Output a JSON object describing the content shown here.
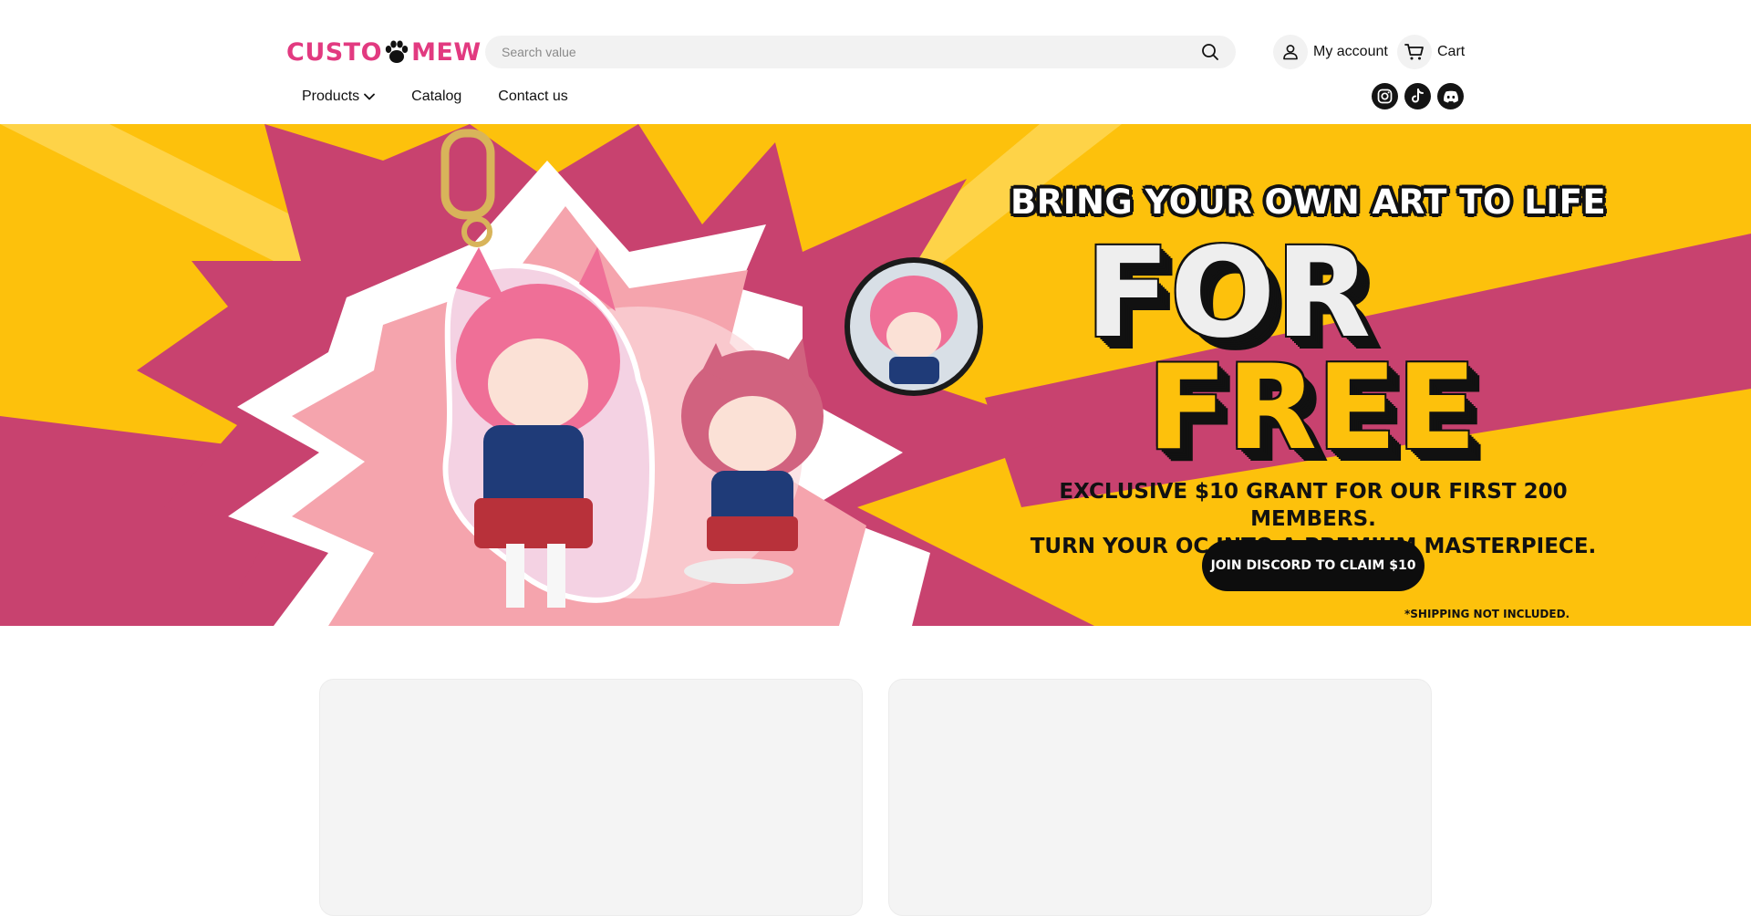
{
  "brand": {
    "logo_left": "CUSTO",
    "logo_right": "MEW",
    "logo_color": "#e23a80"
  },
  "search": {
    "placeholder": "Search value",
    "icon": "search-icon"
  },
  "header": {
    "account_label": "My account",
    "cart_label": "Cart"
  },
  "nav": {
    "items": [
      {
        "label": "Products",
        "has_dropdown": true
      },
      {
        "label": "Catalog",
        "has_dropdown": false
      },
      {
        "label": "Contact us",
        "has_dropdown": false
      }
    ]
  },
  "socials": [
    "instagram-icon",
    "tiktok-icon",
    "discord-icon"
  ],
  "hero": {
    "headline": "BRING YOUR OWN ART TO LIFE",
    "big_1": "FOR",
    "big_2": "FREE",
    "subline_1": "EXCLUSIVE $10 GRANT FOR OUR FIRST 200 MEMBERS.",
    "subline_2": "TURN YOUR OC INTO A PREMIUM MASTERPIECE.",
    "cta_label": "JOIN DISCORD TO CLAIM $10",
    "footnote": "*SHIPPING NOT INCLUDED.",
    "colors": {
      "yellow": "#fdc10c",
      "magenta": "#c8426f",
      "black": "#0d0d0d"
    }
  }
}
